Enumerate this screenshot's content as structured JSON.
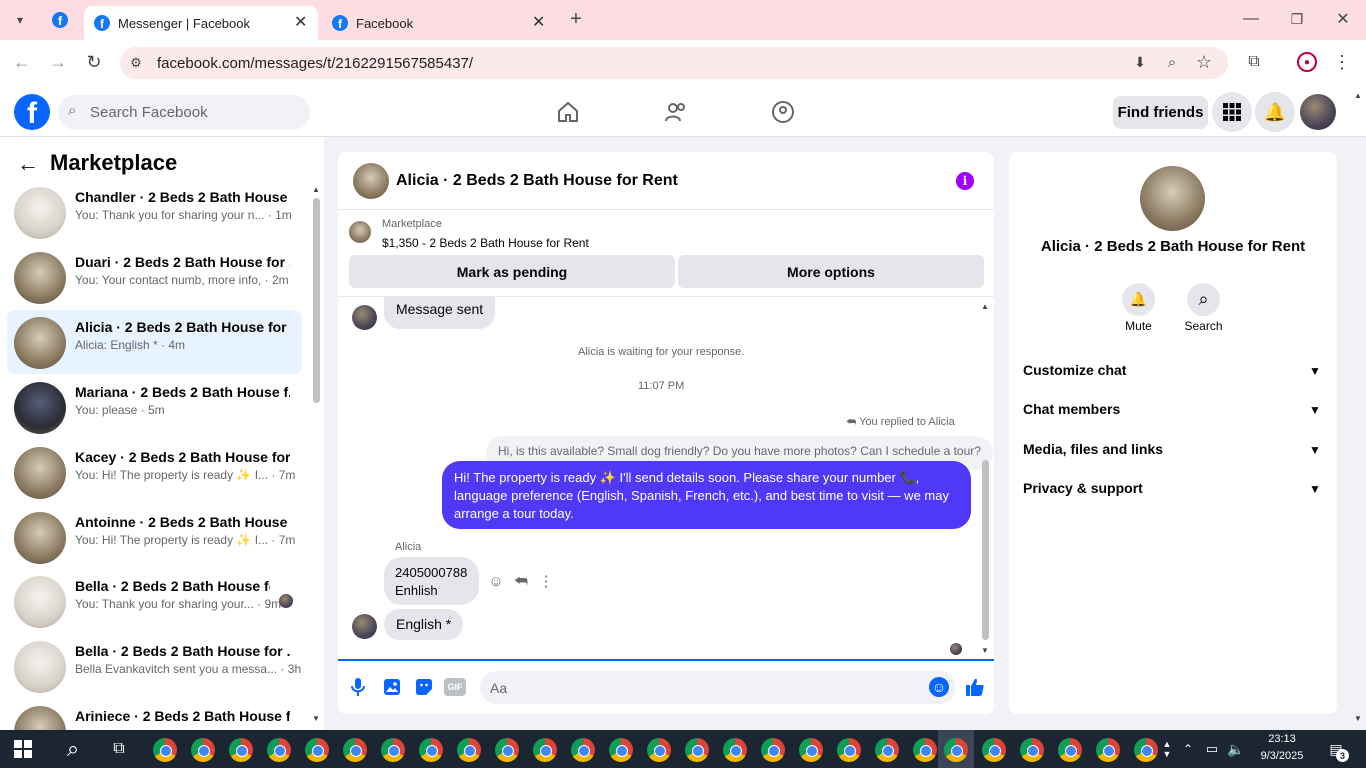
{
  "browser": {
    "tabs": [
      {
        "title": "Messenger | Facebook"
      },
      {
        "title": "Facebook"
      }
    ],
    "url": "facebook.com/messages/t/2162291567585437/"
  },
  "header": {
    "search_placeholder": "Search Facebook",
    "find_friends": "Find friends"
  },
  "sidebar": {
    "title": "Marketplace",
    "conversations": [
      {
        "title": "Chandler · 2 Beds 2 Bath House ...",
        "sub": "You: Thank you for sharing your n... · 1m"
      },
      {
        "title": "Duari · 2 Beds 2 Bath House for ...",
        "sub": "You: Your contact numb, more info, · 2m"
      },
      {
        "title": "Alicia · 2 Beds 2 Bath House for ...",
        "sub": "Alicia: English * · 4m"
      },
      {
        "title": "Mariana · 2 Beds 2 Bath House f...",
        "sub": "You: please · 5m"
      },
      {
        "title": "Kacey · 2 Beds 2 Bath House for...",
        "sub": "You: Hi! The property is ready ✨ I... · 7m"
      },
      {
        "title": "Antoinne · 2 Beds 2 Bath House ...",
        "sub": "You: Hi! The property is ready ✨ I... · 7m"
      },
      {
        "title": "Bella · 2 Beds 2 Bath House fo...",
        "sub": "You: Thank you for sharing your... · 9m"
      },
      {
        "title": "Bella · 2 Beds 2 Bath House for ...",
        "sub": "Bella Evankavitch sent you a messa... · 3h"
      },
      {
        "title": "Ariniece · 2 Beds 2 Bath House f...",
        "sub": ""
      }
    ]
  },
  "chat": {
    "title": "Alicia · 2 Beds 2 Bath House for Rent",
    "listing_source": "Marketplace",
    "listing": "$1,350 - 2 Beds 2 Bath House for Rent",
    "mark_pending": "Mark as pending",
    "more_options": "More options",
    "message_sent": "Message sent",
    "waiting": "Alicia is waiting for your response.",
    "time": "11:07 PM",
    "replied_to": "You replied to Alicia",
    "quoted": "Hi, is this available? Small dog friendly? Do you have more photos? Can I schedule a tour?",
    "my_message": "Hi! The property is ready ✨ I'll send details soon. Please share your number 📞, language preference (English, Spanish, French, etc.), and best time to visit — we may arrange a tour today.",
    "sender_name": "Alicia",
    "msg1_line1": "2405000788",
    "msg1_line2": "Enhlish",
    "msg2": "English *",
    "input_placeholder": "Aa"
  },
  "details": {
    "name": "Alicia · 2 Beds 2 Bath House for Rent",
    "mute": "Mute",
    "search": "Search",
    "sections": [
      "Customize chat",
      "Chat members",
      "Media, files and links",
      "Privacy & support"
    ]
  },
  "taskbar": {
    "time": "23:13",
    "date": "9/3/2025",
    "notifications": "3"
  },
  "colors": {
    "accent_blue": "#0866ff",
    "bubble_purple": "#4f38f6",
    "selected_row": "#e7f3ff"
  }
}
